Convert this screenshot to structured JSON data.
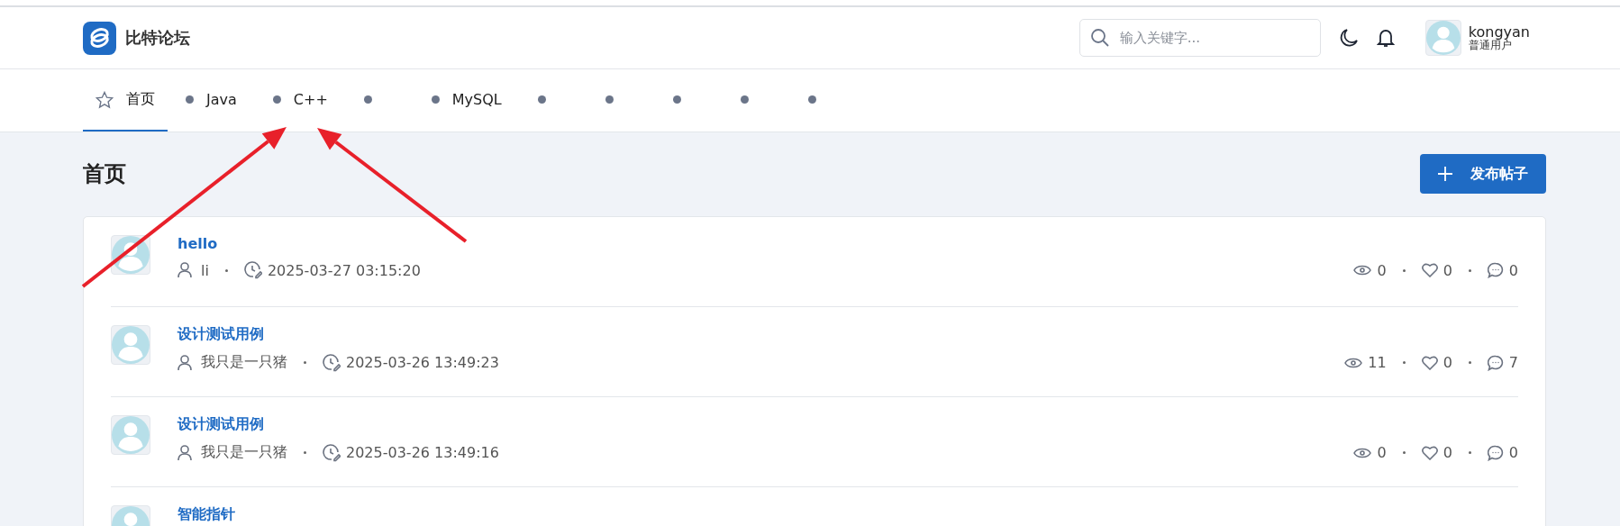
{
  "header": {
    "site_name": "比特论坛",
    "search": {
      "placeholder": "输入关键字..."
    },
    "user": {
      "name": "kongyan",
      "role": "普通用户"
    }
  },
  "nav": [
    {
      "kind": "home",
      "label": "首页",
      "selected": true
    },
    {
      "kind": "board",
      "label": "Java",
      "selected": false
    },
    {
      "kind": "board",
      "label": "C++",
      "selected": false
    },
    {
      "kind": "board",
      "selected": false
    },
    {
      "kind": "board",
      "label": "MySQL",
      "selected": false
    },
    {
      "kind": "board",
      "selected": false
    },
    {
      "kind": "board",
      "selected": false
    },
    {
      "kind": "board",
      "selected": false
    },
    {
      "kind": "board",
      "selected": false
    },
    {
      "kind": "board",
      "selected": false
    }
  ],
  "page": {
    "title": "首页",
    "new_post_button": "发布帖子"
  },
  "posts": [
    {
      "title": "hello",
      "author": "li",
      "time": "2025-03-27 03:15:20",
      "views": "0",
      "likes": "0",
      "replies": "0"
    },
    {
      "title": "设计测试用例",
      "author": "我只是一只猪",
      "time": "2025-03-26 13:49:23",
      "views": "11",
      "likes": "0",
      "replies": "7"
    },
    {
      "title": "设计测试用例",
      "author": "我只是一只猪",
      "time": "2025-03-26 13:49:16",
      "views": "0",
      "likes": "0",
      "replies": "0"
    },
    {
      "title": "智能指针"
    }
  ],
  "annotations": [
    {
      "kind": "arrow"
    },
    {
      "kind": "arrow"
    }
  ]
}
